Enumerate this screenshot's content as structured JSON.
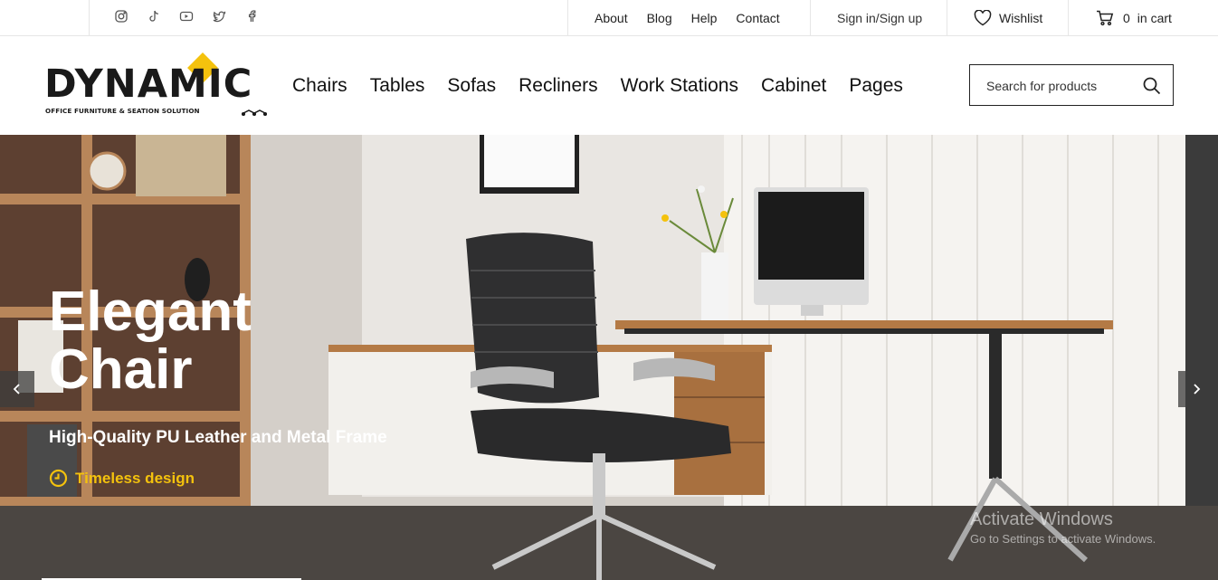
{
  "topbar": {
    "social": [
      {
        "icon": "instagram-icon"
      },
      {
        "icon": "tiktok-icon"
      },
      {
        "icon": "youtube-icon"
      },
      {
        "icon": "twitter-icon"
      },
      {
        "icon": "facebook-icon"
      }
    ],
    "links": [
      "About",
      "Blog",
      "Help",
      "Contact"
    ],
    "signin": "Sign in/Sign up",
    "wishlist": "Wishlist",
    "cart_count": "0",
    "cart_label": "in cart"
  },
  "header": {
    "logo_word": "DYNAMIC",
    "logo_tagline": "OFFICE FURNITURE & SEATION SOLUTION",
    "nav": [
      "Chairs",
      "Tables",
      "Sofas",
      "Recliners",
      "Work Stations",
      "Cabinet",
      "Pages"
    ],
    "search_placeholder": "Search for products"
  },
  "hero": {
    "title_line1": "Elegant",
    "title_line2": "Chair",
    "subtitle": "High-Quality PU Leather and Metal Frame",
    "feature": "Timeless design",
    "watermark_line1": "Activate Windows",
    "watermark_line2": "Go to Settings to activate Windows."
  },
  "colors": {
    "accent": "#f4c20d",
    "text": "#111111",
    "border": "#e6e6e6"
  }
}
